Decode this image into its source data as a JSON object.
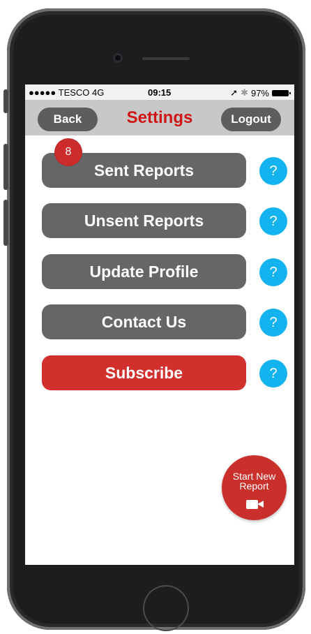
{
  "status_bar": {
    "carrier": "●●●●● TESCO  4G",
    "time": "09:15",
    "location_icon": "➚",
    "bluetooth_icon": "✱",
    "battery": "97%"
  },
  "nav": {
    "back": "Back",
    "title": "Settings",
    "logout": "Logout"
  },
  "menu": [
    {
      "label": "Sent Reports",
      "color": "#666666"
    },
    {
      "label": "Unsent Reports",
      "color": "#666666"
    },
    {
      "label": "Update Profile",
      "color": "#666666"
    },
    {
      "label": "Contact Us",
      "color": "#666666"
    },
    {
      "label": "Subscribe",
      "color": "#d2302d"
    }
  ],
  "help_label": "?",
  "badge": "8",
  "fab": {
    "line1": "Start New",
    "line2": "Report",
    "icon": "video-camera-icon"
  },
  "colors": {
    "accent_red": "#cf1515",
    "help_blue": "#12b3ef",
    "button_gray": "#666666"
  }
}
